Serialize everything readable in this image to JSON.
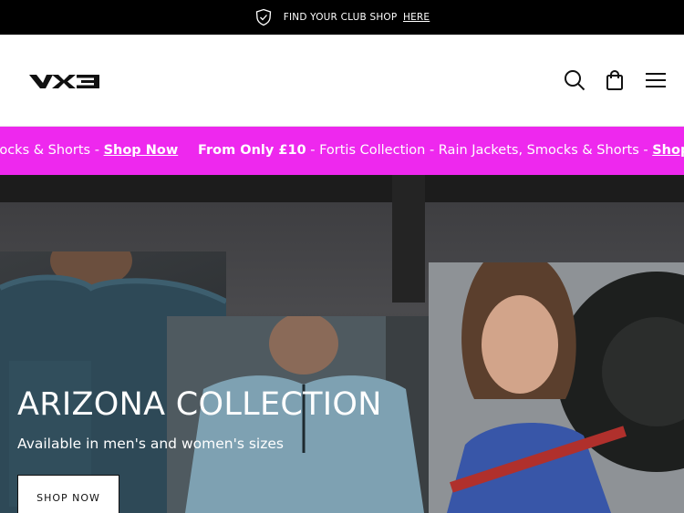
{
  "announcement": {
    "text": "FIND YOUR CLUB SHOP",
    "link": "HERE",
    "icon": "shield-check-icon"
  },
  "header": {
    "logo_text": "VX3",
    "icons": [
      "search-icon",
      "bag-icon",
      "menu-icon"
    ]
  },
  "promo": {
    "segment1_text": "Smocks & Shorts - ",
    "segment1_link": "Shop Now",
    "segment2_bold": "From Only £10",
    "segment2_text": " - Fortis Collection - Rain Jackets, Smocks & Shorts - ",
    "segment2_link": "Shop Now",
    "background": "#ee28ee"
  },
  "hero": {
    "title": "ARIZONA COLLECTION",
    "subtitle": "Available in men's and women's sizes",
    "button": "SHOP NOW"
  }
}
